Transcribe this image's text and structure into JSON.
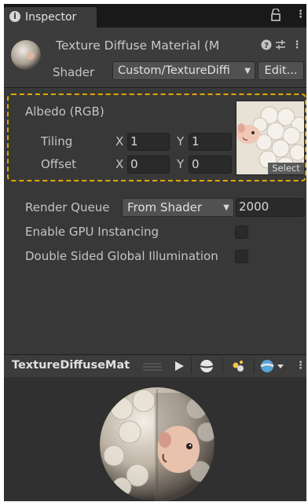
{
  "tab": {
    "title": "Inspector"
  },
  "header": {
    "material_title": "Texture Diffuse Material (M",
    "shader_label": "Shader",
    "shader_value": "Custom/TextureDiffi",
    "edit_label": "Edit..."
  },
  "albedo": {
    "label": "Albedo (RGB)",
    "tiling_label": "Tiling",
    "offset_label": "Offset",
    "x_axis": "X",
    "y_axis": "Y",
    "tiling_x": "1",
    "tiling_y": "1",
    "offset_x": "0",
    "offset_y": "0",
    "select_label": "Select"
  },
  "render_queue": {
    "label": "Render Queue",
    "mode": "From Shader",
    "value": "2000"
  },
  "gpu_instancing": {
    "label": "Enable GPU Instancing",
    "checked": false
  },
  "double_sided_gi": {
    "label": "Double Sided Global Illumination",
    "checked": false
  },
  "preview": {
    "title": "TextureDiffuseMat"
  },
  "colors": {
    "highlight": "#e0a800",
    "panel": "#383838",
    "header": "#3c3c3c"
  }
}
